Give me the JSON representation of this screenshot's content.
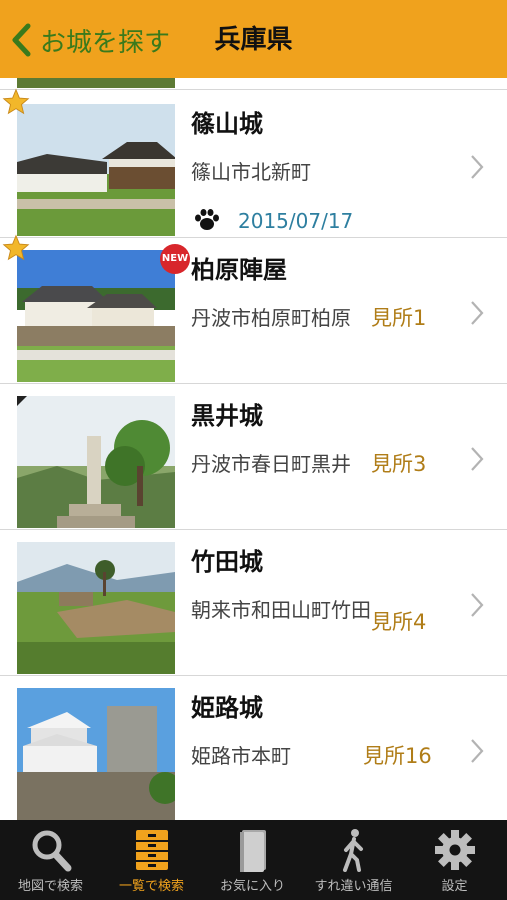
{
  "header": {
    "back_label": "お城を探す",
    "title": "兵庫県"
  },
  "castles": [
    {
      "name": "篠山城",
      "address": "篠山市北新町",
      "spots": "",
      "visited_date": "2015/07/17",
      "new_badge": ""
    },
    {
      "name": "柏原陣屋",
      "address": "丹波市柏原町柏原",
      "spots": "見所1",
      "visited_date": "",
      "new_badge": "NEW"
    },
    {
      "name": "黒井城",
      "address": "丹波市春日町黒井",
      "spots": "見所3",
      "visited_date": "",
      "new_badge": ""
    },
    {
      "name": "竹田城",
      "address": "朝来市和田山町竹田",
      "spots": "見所4",
      "visited_date": "",
      "new_badge": ""
    },
    {
      "name": "姫路城",
      "address": "姫路市本町",
      "spots": "見所16",
      "visited_date": "",
      "new_badge": ""
    }
  ],
  "tabs": [
    {
      "label": "地図で検索",
      "icon": "search-icon",
      "active": false
    },
    {
      "label": "一覧で検索",
      "icon": "list-icon",
      "active": true
    },
    {
      "label": "お気に入り",
      "icon": "book-icon",
      "active": false
    },
    {
      "label": "すれ違い通信",
      "icon": "walker-icon",
      "active": false
    },
    {
      "label": "設定",
      "icon": "gear-icon",
      "active": false
    }
  ],
  "colors": {
    "header": "#f0a21d",
    "back": "#3a7a1c",
    "spots": "#b07d18",
    "date": "#2e7fa0",
    "tabbar": "#141414"
  }
}
